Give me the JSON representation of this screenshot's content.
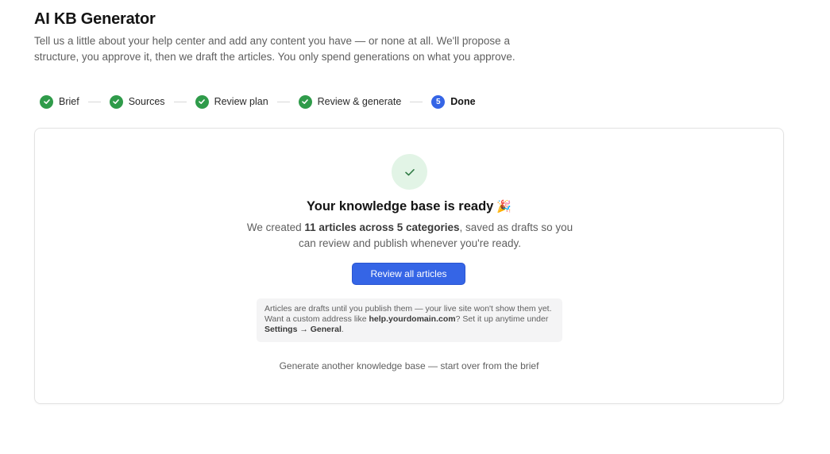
{
  "app": {
    "title": "AI KB Generator",
    "intro": "Tell us a little about your help center and add any content you have — or none at all. We'll propose a structure, you approve it, then we draft the articles. You only spend generations on what you approve."
  },
  "stepper": {
    "steps": [
      {
        "label": "Brief",
        "status": "complete"
      },
      {
        "label": "Sources",
        "status": "complete"
      },
      {
        "label": "Review plan",
        "status": "complete"
      },
      {
        "label": "Review & generate",
        "status": "complete"
      },
      {
        "label": "Done",
        "status": "current",
        "number": "5"
      }
    ]
  },
  "result": {
    "title": "Your knowledge base is ready",
    "emoji": "🎉",
    "desc_prefix": "We created ",
    "desc_bold": "11 articles across 5 categories",
    "desc_suffix": ", saved as drafts so you can review and publish whenever you're ready.",
    "primary_button": "Review all articles",
    "note": {
      "line1": "Articles are drafts until you publish them — your live site won't show them yet.",
      "line2_prefix": "Want a custom address like ",
      "domain": "help.yourdomain.com",
      "line2_suffix": "? Set it up anytime under ",
      "settings_path": "Settings → General",
      "end": "."
    },
    "restart_link": "Generate another knowledge base — start over from the brief"
  },
  "colors": {
    "accent": "#3565e6",
    "success": "#2f9b4a",
    "success_bg": "#e2f4e6",
    "note_bg": "#f4f4f5",
    "muted_text": "#5f5f5f"
  },
  "icons": {
    "step_complete": "check-icon",
    "success": "check-icon"
  }
}
